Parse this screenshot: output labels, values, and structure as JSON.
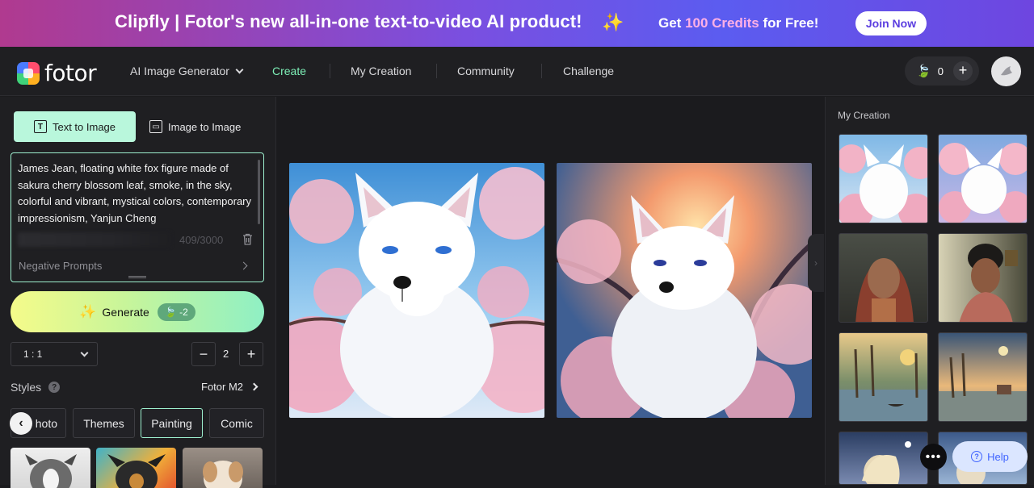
{
  "banner": {
    "headline": "Clipfly | Fotor's new all-in-one text-to-video AI product!",
    "sparkle_icon": "sparkle-icon",
    "credits_prefix": "Get ",
    "credits_highlight": "100 Credits",
    "credits_suffix": " for Free!",
    "join_label": "Join Now"
  },
  "nav": {
    "logo_text": "fotor",
    "items": [
      {
        "label": "AI Image Generator"
      },
      {
        "label": "Create"
      },
      {
        "label": "My Creation"
      },
      {
        "label": "Community"
      },
      {
        "label": "Challenge"
      }
    ],
    "credits": "0",
    "plus_label": "+"
  },
  "left": {
    "tab_text_to_image": "Text to Image",
    "tab_image_to_image": "Image to Image",
    "prompt": "James Jean, floating white fox figure made of sakura cherry blossom leaf, smoke, in the sky, colorful and vibrant, mystical colors, contemporary impressionism, Yanjun Cheng",
    "counter": "409/3000",
    "negative_prompts": "Negative Prompts",
    "generate_label": "Generate",
    "generate_cost": "-2",
    "ratio": "1 : 1",
    "quantity": "2",
    "minus_label": "−",
    "plus_label": "+",
    "styles_label": "Styles",
    "help_glyph": "?",
    "model": "Fotor M2",
    "style_tabs": [
      "hoto",
      "Themes",
      "Painting",
      "Comic"
    ],
    "back_glyph": "‹"
  },
  "right": {
    "title": "My Creation"
  },
  "floating": {
    "more_glyph": "•••",
    "help_label": "Help",
    "help_glyph": "?"
  },
  "colors": {
    "accent": "#7ef0b8",
    "banner_start": "#b03a8f",
    "banner_end": "#6e46e0",
    "help_blue": "#3f64ff"
  }
}
